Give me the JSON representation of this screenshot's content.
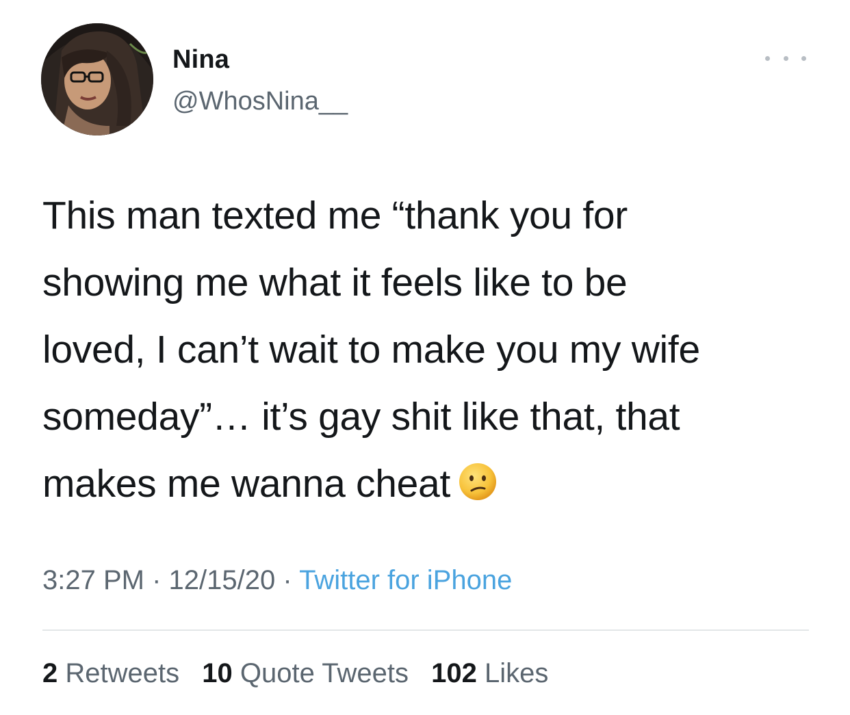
{
  "tweet": {
    "author": {
      "name": "Nina",
      "handle": "@WhosNina__"
    },
    "text_lines": [
      "This man texted me “thank you for",
      "showing me what it feels like to be",
      "loved, I can’t wait to make you my wife",
      "someday”… it’s gay shit like that, that",
      "makes me wanna cheat"
    ],
    "emoji": "confused-face",
    "time": "3:27 PM",
    "separator": "·",
    "date": "12/15/20",
    "source": "Twitter for iPhone",
    "stats": {
      "retweets_count": "2",
      "retweets_label": "Retweets",
      "quotes_count": "10",
      "quotes_label": "Quote Tweets",
      "likes_count": "102",
      "likes_label": "Likes"
    }
  }
}
